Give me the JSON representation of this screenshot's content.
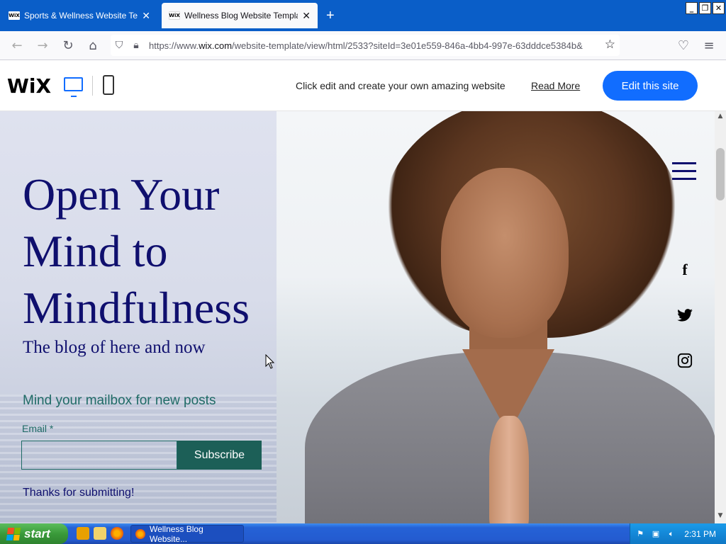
{
  "browser": {
    "tabs": [
      {
        "favicon": "WiX",
        "title": "Sports & Wellness Website Templat",
        "active": false
      },
      {
        "favicon": "WiX",
        "title": "Wellness Blog Website Template | W",
        "active": true
      }
    ],
    "new_tab_icon": "+",
    "window_controls": [
      "_",
      "❐",
      "✕"
    ],
    "url_prefix": "https://www.",
    "url_domain": "wix.com",
    "url_rest": "/website-template/view/html/2533?siteId=3e01e559-846a-4bb4-997e-63dddce5384b&"
  },
  "wix_header": {
    "logo": "WiX",
    "promo_text": "Click edit and create your own amazing website",
    "read_more": "Read More",
    "edit_button": "Edit this site"
  },
  "hero": {
    "title_lines": [
      "Open Your",
      "Mind to",
      "Mindfulness"
    ],
    "subtitle": "The blog of here and now",
    "mailbox_text": "Mind your mailbox for new posts",
    "email_label": "Email *",
    "email_value": "",
    "subscribe_button": "Subscribe",
    "thanks_text": "Thanks for submitting!"
  },
  "social": {
    "facebook": "f",
    "twitter": "twitter-icon",
    "instagram": "instagram-icon"
  },
  "taskbar": {
    "start_label": "start",
    "task_item": "Wellness Blog Website...",
    "clock": "2:31 PM"
  },
  "colors": {
    "wix_blue": "#116dff",
    "title_navy": "#0f0f6e",
    "teal": "#1f6b66",
    "subscribe_bg": "#1c5f57"
  }
}
